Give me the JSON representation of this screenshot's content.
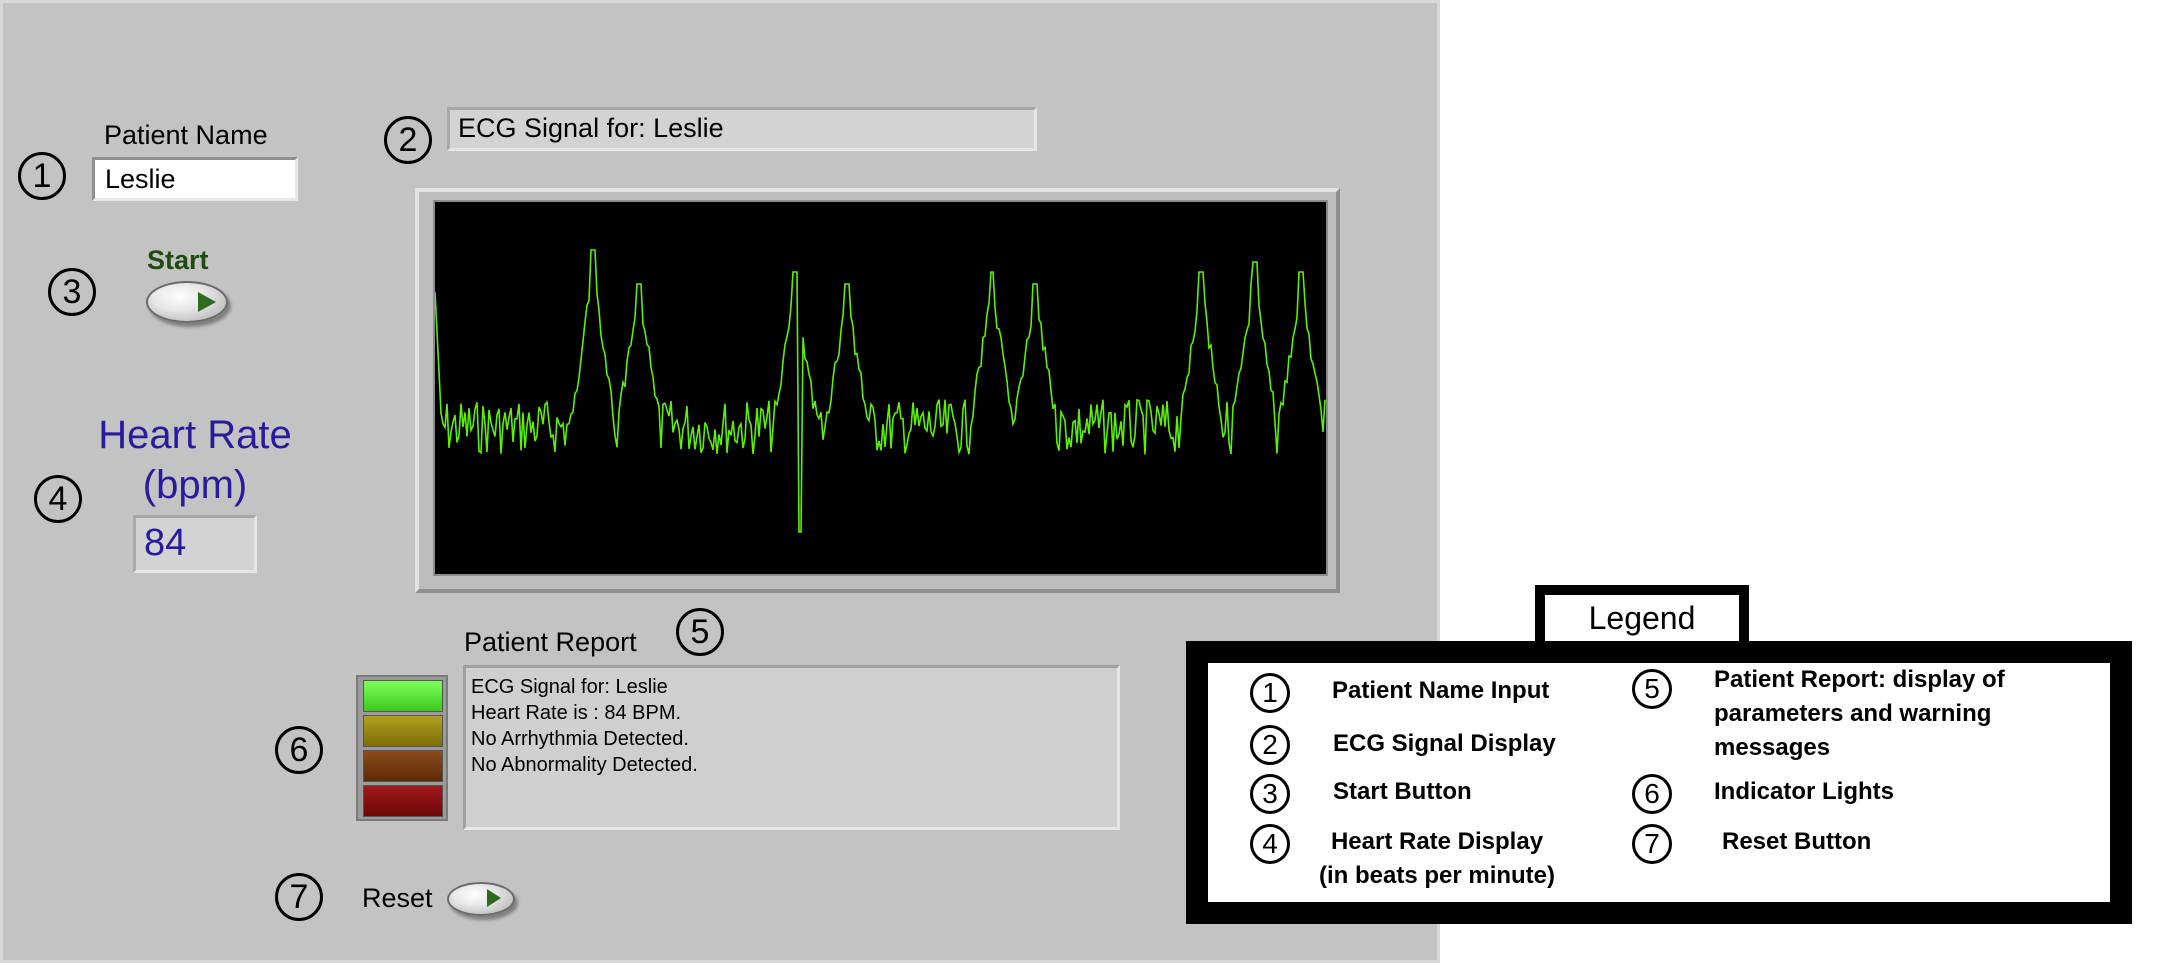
{
  "patient": {
    "name_label": "Patient Name",
    "name_value": "Leslie"
  },
  "ecg": {
    "title_value": "ECG Signal for:  Leslie",
    "trace_color": "#5cf000"
  },
  "start": {
    "label": "Start"
  },
  "heart_rate": {
    "label_line1": "Heart Rate",
    "label_line2": "(bpm)",
    "value": "84",
    "color": "#2a1a9e"
  },
  "report": {
    "label": "Patient Report",
    "lines": [
      "ECG Signal for:  Leslie",
      "Heart Rate is :  84  BPM.",
      "No Arrhythmia Detected.",
      "No Abnormality Detected."
    ]
  },
  "indicators": {
    "colors": [
      "#4fe82a",
      "#9a8a10",
      "#7a3a10",
      "#8a1010"
    ]
  },
  "reset": {
    "label": "Reset"
  },
  "markers": [
    "1",
    "2",
    "3",
    "4",
    "5",
    "6",
    "7"
  ],
  "legend": {
    "title": "Legend",
    "items": [
      {
        "num": "1",
        "text": "Patient Name Input"
      },
      {
        "num": "2",
        "text": "ECG Signal Display"
      },
      {
        "num": "3",
        "text": "Start Button"
      },
      {
        "num": "4",
        "text_line1": "Heart Rate Display",
        "text_line2": "(in beats per minute)"
      },
      {
        "num": "5",
        "text_line1": "Patient Report: display of",
        "text_line2": "parameters and warning messages"
      },
      {
        "num": "6",
        "text": "Indicator Lights"
      },
      {
        "num": "7",
        "text": "Reset Button"
      }
    ]
  }
}
